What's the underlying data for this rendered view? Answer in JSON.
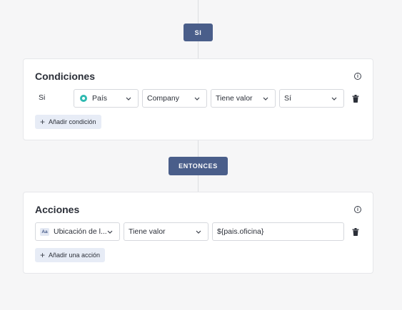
{
  "flow": {
    "if_label": "SI",
    "then_label": "ENTONCES"
  },
  "conditions": {
    "title": "Condiciones",
    "row_label": "Si",
    "field": "País",
    "field_icon": "country-icon",
    "object": "Company",
    "operator": "Tiene valor",
    "value": "Sí",
    "add_label": "Añadir condición"
  },
  "actions": {
    "title": "Acciones",
    "field": "Ubicación de l...",
    "field_icon": "text-field-icon",
    "field_icon_text": "Aa",
    "operator": "Tiene valor",
    "value": "${pais.oficina}",
    "add_label": "Añadir una acción"
  },
  "colors": {
    "pill": "#4a5e8a",
    "add_button_bg": "#e7ecf6",
    "country_icon": "#2fb9b0",
    "background": "#f6f6f7"
  }
}
